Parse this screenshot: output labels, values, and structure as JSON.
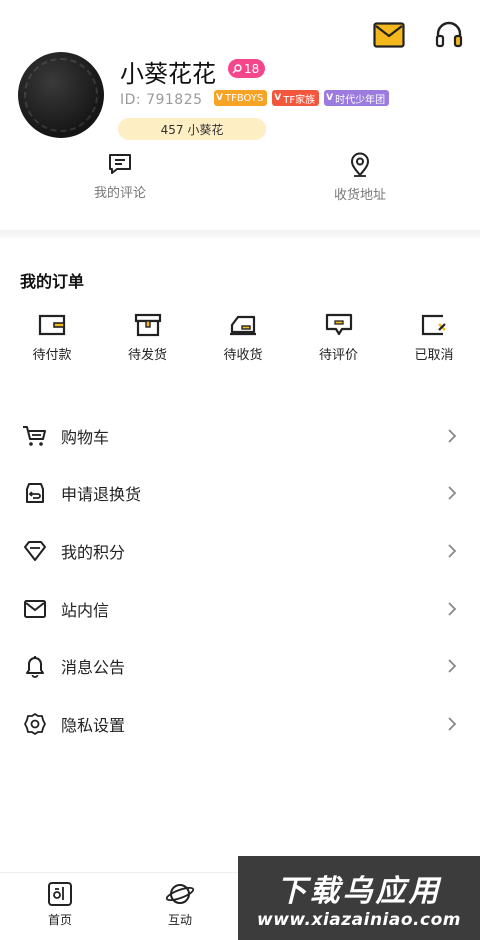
{
  "header": {
    "icons": [
      "mail-icon",
      "headset-icon"
    ]
  },
  "profile": {
    "name": "小葵花花",
    "level": "18",
    "id_label": "ID: 791825",
    "tags": [
      {
        "label": "TFBOYS",
        "color": "#f7a325"
      },
      {
        "label": "TF家族",
        "color": "#f2563d"
      },
      {
        "label": "时代少年团",
        "color": "#9b7bde"
      }
    ],
    "fans_badge": "457 小葵花"
  },
  "quick_links": [
    {
      "label": "我的评论",
      "icon": "comment-icon"
    },
    {
      "label": "收货地址",
      "icon": "location-icon"
    }
  ],
  "orders": {
    "title": "我的订单",
    "items": [
      {
        "label": "待付款",
        "icon": "wallet-icon"
      },
      {
        "label": "待发货",
        "icon": "box-icon"
      },
      {
        "label": "待收货",
        "icon": "truck-icon"
      },
      {
        "label": "待评价",
        "icon": "review-icon"
      },
      {
        "label": "已取消",
        "icon": "cancel-icon"
      }
    ]
  },
  "menu": [
    {
      "label": "购物车",
      "icon": "cart-icon"
    },
    {
      "label": "申请退换货",
      "icon": "return-icon"
    },
    {
      "label": "我的积分",
      "icon": "diamond-icon"
    },
    {
      "label": "站内信",
      "icon": "envelope-icon"
    },
    {
      "label": "消息公告",
      "icon": "bell-icon"
    },
    {
      "label": "隐私设置",
      "icon": "settings-icon"
    }
  ],
  "tabbar": [
    {
      "label": "首页",
      "icon": "home-icon"
    },
    {
      "label": "互动",
      "icon": "planet-icon"
    }
  ],
  "watermark": {
    "title": "下载乌应用",
    "url": "www.xiazainiao.com"
  },
  "colors": {
    "accent": "#f5b81c",
    "level_badge": "#f4468b",
    "fans_badge_bg": "#fdeec4"
  }
}
